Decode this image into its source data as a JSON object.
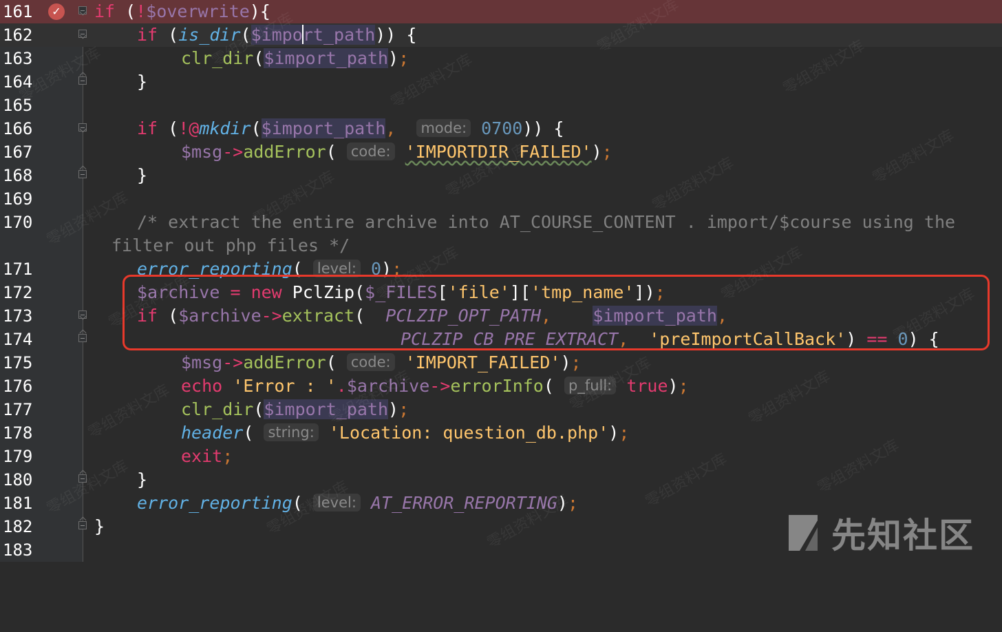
{
  "editor": {
    "lines": [
      {
        "n": "161"
      },
      {
        "n": "162"
      },
      {
        "n": "163"
      },
      {
        "n": "164"
      },
      {
        "n": "165"
      },
      {
        "n": "166"
      },
      {
        "n": "167"
      },
      {
        "n": "168"
      },
      {
        "n": "169"
      },
      {
        "n": "170"
      },
      {
        "n": "171"
      },
      {
        "n": "172"
      },
      {
        "n": "173"
      },
      {
        "n": "174"
      },
      {
        "n": "175"
      },
      {
        "n": "176"
      },
      {
        "n": "177"
      },
      {
        "n": "178"
      },
      {
        "n": "179"
      },
      {
        "n": "180"
      },
      {
        "n": "181"
      },
      {
        "n": "182"
      },
      {
        "n": "183"
      }
    ],
    "tokens": {
      "if": "if",
      "new": "new",
      "echo": "echo",
      "exit": "exit",
      "overwrite": "$overwrite",
      "is_dir": "is_dir",
      "import_path": "$import_path",
      "import_path_a": "$impo",
      "import_path_b": "rt_path",
      "clr_dir": "clr_dir",
      "mkdir": "mkdir",
      "msg": "$msg",
      "addError": "addError",
      "hint_mode": "mode:",
      "hint_code": "code:",
      "hint_level": "level:",
      "hint_p_full": "p_full:",
      "hint_string": "string:",
      "octal": "0700",
      "zero": "0",
      "str_importdir_failed": "'IMPORTDIR_FAILED'",
      "str_import_failed": "'IMPORT_FAILED'",
      "comment_1": "/* extract the entire archive into AT_COURSE_CONTENT . import/$course using the",
      "comment_2": "filter out php files */",
      "error_reporting": "error_reporting",
      "archive": "$archive",
      "PclZip": "PclZip",
      "files": "$_FILES",
      "str_file": "'file'",
      "str_tmp_name": "'tmp_name'",
      "extract": "extract",
      "opt_path": "PCLZIP_OPT_PATH",
      "cb_pre_extract": "PCLZIP_CB_PRE_EXTRACT",
      "str_callback": "'preImportCallBack'",
      "str_error": "'Error : '",
      "errorInfo": "errorInfo",
      "true": "true",
      "header": "header",
      "str_location": "'Location: question_db.php'",
      "at_error_reporting": "AT_ERROR_REPORTING"
    }
  },
  "watermark": {
    "text": "零组资料文库"
  },
  "logo": {
    "text": "先知社区"
  },
  "colors": {
    "background": "#2b2b2b",
    "breakpoint_line": "#663538",
    "highlight_box": "#e8392b"
  }
}
